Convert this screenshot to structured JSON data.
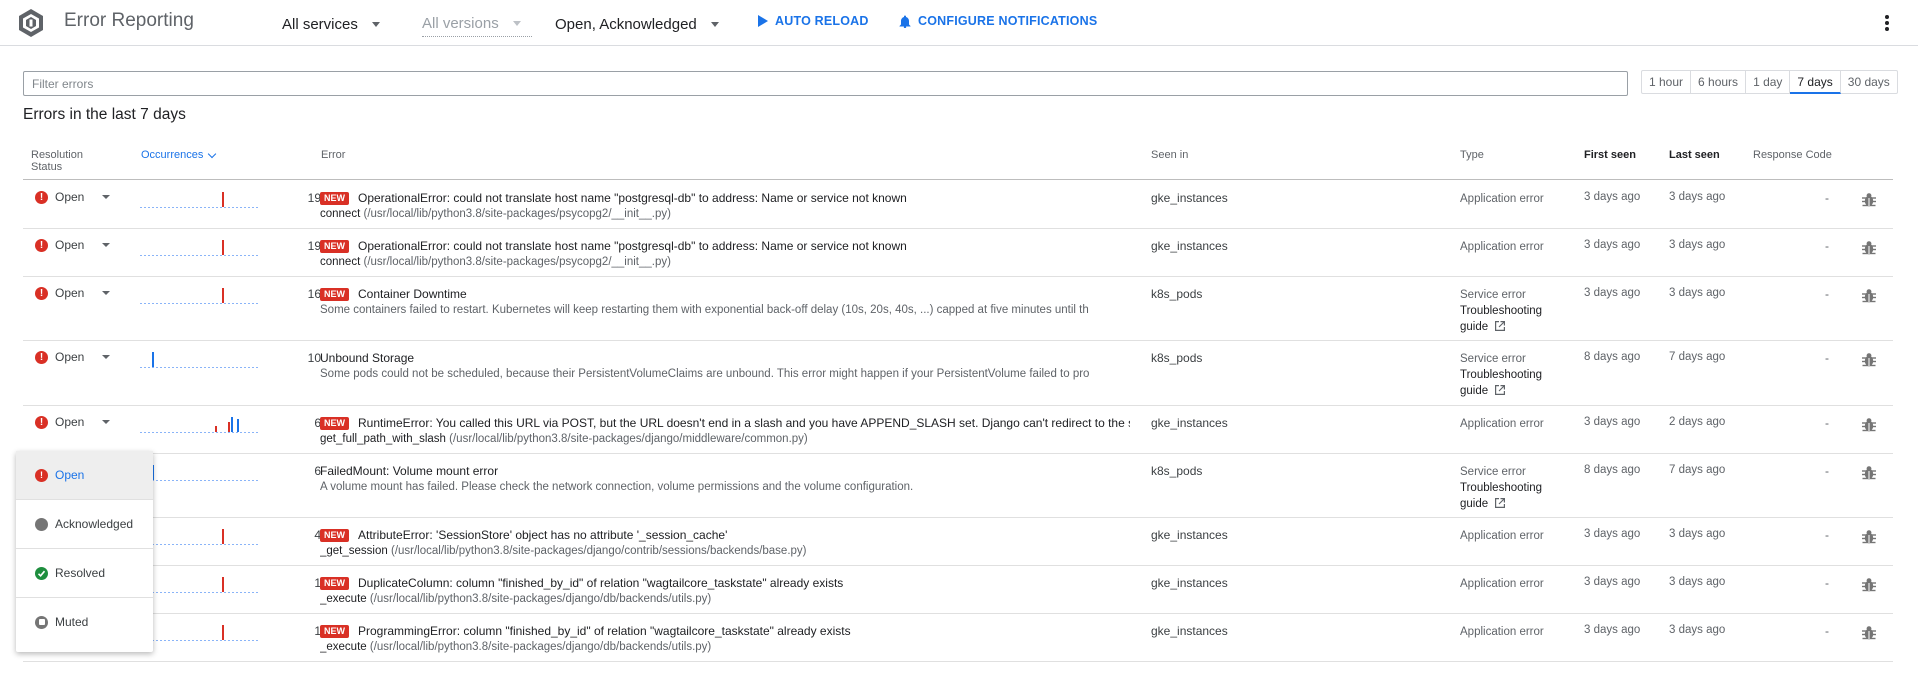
{
  "header": {
    "app_title": "Error Reporting",
    "services": "All services",
    "versions": "All versions",
    "status_filter": "Open, Acknowledged",
    "auto_reload": "AUTO RELOAD",
    "configure_notifications": "CONFIGURE NOTIFICATIONS"
  },
  "filter": {
    "placeholder": "Filter errors"
  },
  "time_ranges": [
    "1 hour",
    "6 hours",
    "1 day",
    "7 days",
    "30 days"
  ],
  "active_range": "7 days",
  "heading": "Errors in the last 7 days",
  "columns": {
    "resolution_status_1": "Resolution",
    "resolution_status_2": "Status",
    "occurrences": "Occurrences",
    "error": "Error",
    "seen_in": "Seen in",
    "type": "Type",
    "first_seen": "First seen",
    "last_seen": "Last seen",
    "response_code": "Response Code"
  },
  "rows": [
    {
      "status": "Open",
      "count": "19",
      "new": "NEW",
      "title": "OperationalError: could not translate host name \"postgresql-db\" to address: Name or service not known",
      "fn": "connect",
      "loc": "(/usr/local/lib/python3.8/site-packages/psycopg2/__init__.py)",
      "seen_in": "gke_instances",
      "type": "Application error",
      "guide": "",
      "first_seen": "3 days ago",
      "last_seen": "3 days ago",
      "response": "-"
    },
    {
      "status": "Open",
      "count": "19",
      "new": "NEW",
      "title": "OperationalError: could not translate host name \"postgresql-db\" to address: Name or service not known",
      "fn": "connect",
      "loc": "(/usr/local/lib/python3.8/site-packages/psycopg2/__init__.py)",
      "seen_in": "gke_instances",
      "type": "Application error",
      "guide": "",
      "first_seen": "3 days ago",
      "last_seen": "3 days ago",
      "response": "-"
    },
    {
      "status": "Open",
      "count": "16",
      "new": "NEW",
      "title": "Container Downtime",
      "fn": "",
      "loc": "Some containers failed to restart. Kubernetes will keep restarting them with exponential back-off delay (10s, 20s, 40s, ...) capped at five minutes until th",
      "seen_in": "k8s_pods",
      "type": "Service error",
      "guide": "Troubleshooting guide",
      "first_seen": "3 days ago",
      "last_seen": "3 days ago",
      "response": "-"
    },
    {
      "status": "Open",
      "count": "10",
      "new": "",
      "title": "Unbound Storage",
      "fn": "",
      "loc": "Some pods could not be scheduled, because their PersistentVolumeClaims are unbound. This error might happen if your PersistentVolume failed to pro",
      "seen_in": "k8s_pods",
      "type": "Service error",
      "guide": "Troubleshooting guide",
      "first_seen": "8 days ago",
      "last_seen": "7 days ago",
      "response": "-"
    },
    {
      "status": "Open",
      "count": "6",
      "new": "NEW",
      "title": "RuntimeError: You called this URL via POST, but the URL doesn't end in a slash and you have APPEND_SLASH set. Django can't redirect to the sla",
      "fn": "get_full_path_with_slash",
      "loc": "(/usr/local/lib/python3.8/site-packages/django/middleware/common.py)",
      "seen_in": "gke_instances",
      "type": "Application error",
      "guide": "",
      "first_seen": "3 days ago",
      "last_seen": "2 days ago",
      "response": "-"
    },
    {
      "status": "",
      "count": "6",
      "new": "",
      "title": "FailedMount: Volume mount error",
      "fn": "",
      "loc": "A volume mount has failed. Please check the network connection, volume permissions and the volume configuration.",
      "seen_in": "k8s_pods",
      "type": "Service error",
      "guide": "Troubleshooting guide",
      "first_seen": "8 days ago",
      "last_seen": "7 days ago",
      "response": "-"
    },
    {
      "status": "",
      "count": "4",
      "new": "NEW",
      "title": "AttributeError: 'SessionStore' object has no attribute '_session_cache'",
      "fn": "_get_session",
      "loc": "(/usr/local/lib/python3.8/site-packages/django/contrib/sessions/backends/base.py)",
      "seen_in": "gke_instances",
      "type": "Application error",
      "guide": "",
      "first_seen": "3 days ago",
      "last_seen": "3 days ago",
      "response": "-"
    },
    {
      "status": "",
      "count": "1",
      "new": "NEW",
      "title": "DuplicateColumn: column \"finished_by_id\" of relation \"wagtailcore_taskstate\" already exists",
      "fn": "_execute",
      "loc": "(/usr/local/lib/python3.8/site-packages/django/db/backends/utils.py)",
      "seen_in": "gke_instances",
      "type": "Application error",
      "guide": "",
      "first_seen": "3 days ago",
      "last_seen": "3 days ago",
      "response": "-"
    },
    {
      "status": "",
      "count": "1",
      "new": "NEW",
      "title": "ProgrammingError: column \"finished_by_id\" of relation \"wagtailcore_taskstate\" already exists",
      "fn": "_execute",
      "loc": "(/usr/local/lib/python3.8/site-packages/django/db/backends/utils.py)",
      "seen_in": "gke_instances",
      "type": "Application error",
      "guide": "",
      "first_seen": "3 days ago",
      "last_seen": "3 days ago",
      "response": "-"
    }
  ],
  "status_menu": {
    "items": [
      "Open",
      "Acknowledged",
      "Resolved",
      "Muted"
    ],
    "selected": "Open"
  },
  "colors": {
    "accent": "#1a73e8",
    "error": "#d93025",
    "resolved": "#1e8e3e",
    "spark_bar": "#d93025",
    "spark_bar_alt": "#1a73e8"
  }
}
